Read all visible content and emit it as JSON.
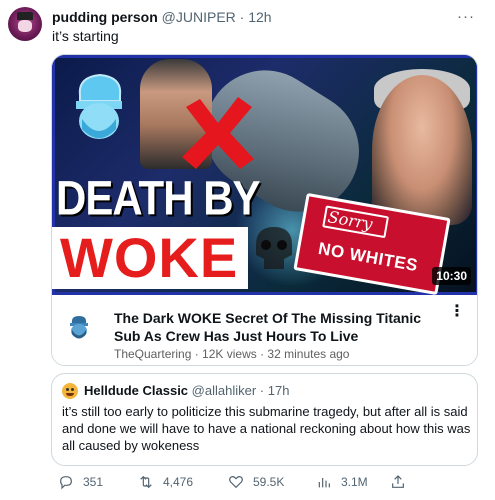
{
  "tweet": {
    "author_name": "pudding person",
    "author_handle": "@JUNIPER",
    "separator": "·",
    "time": "12h",
    "more_label": "···",
    "text": "it’s starting"
  },
  "video_card": {
    "thumbnail": {
      "headline_line1": "DEATH BY",
      "headline_line2": "WOKE",
      "sign_top": "Sorry",
      "sign_bottom": "NO WHITES",
      "duration": "10:30"
    },
    "title": "The Dark WOKE Secret Of The Missing Titanic Sub As Crew Has Just Hours To Live",
    "channel": "TheQuartering",
    "views": "12K views",
    "age": "32 minutes ago",
    "meta_separator": " · ",
    "more_label": "⋮"
  },
  "quote_tweet": {
    "author_name": "Helldude Classic",
    "author_handle": "@allahliker",
    "separator": "·",
    "time": "17h",
    "text": "it’s still too early to politicize this submarine tragedy, but after all is said and done we will have to have a national reckoning about how this was all caused by wokeness"
  },
  "actions": {
    "replies": "351",
    "retweets": "4,476",
    "likes": "59.5K",
    "views": "3.1M"
  },
  "colors": {
    "text_primary": "#0f1419",
    "text_secondary": "#536471",
    "border": "#cfd9de",
    "woke_red": "#e51d1d",
    "sign_red": "#c8102e"
  },
  "icons": [
    "more-icon",
    "blue-head-icon",
    "red-x-icon",
    "skull-icon",
    "channel-icon",
    "reply-icon",
    "retweet-icon",
    "like-icon",
    "views-icon",
    "share-icon"
  ]
}
